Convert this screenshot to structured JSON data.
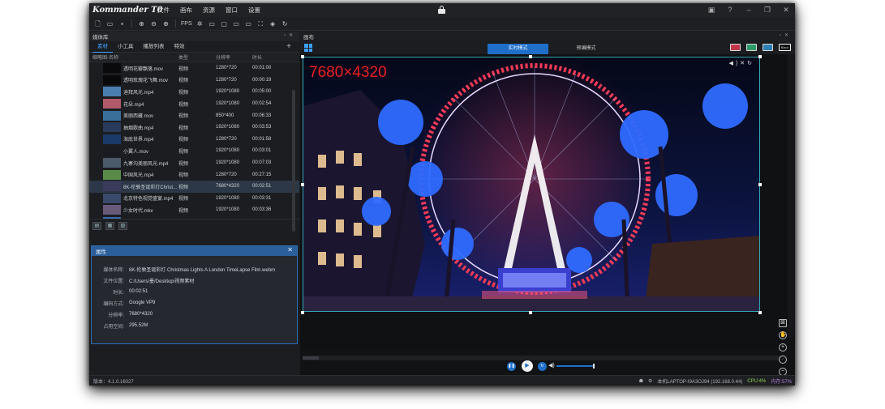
{
  "app": {
    "logo": "Kommander T0"
  },
  "menu": [
    "文件",
    "画布",
    "资源",
    "窗口",
    "设置"
  ],
  "toolbar": {
    "fps_label": "FPS"
  },
  "media_panel": {
    "title": "媒体库",
    "tabs": [
      "素材",
      "小工具",
      "播放列表",
      "特效"
    ],
    "active_tab": "素材",
    "columns": [
      "缩略图-名称",
      "类型",
      "分辨率",
      "时长"
    ],
    "rows": [
      {
        "name": "透明花瓣飘落.mov",
        "type": "视频",
        "res": "1280*720",
        "dur": "00:01:00"
      },
      {
        "name": "透明玫瑰花飞舞.mov",
        "type": "视频",
        "res": "1280*720",
        "dur": "00:00:19"
      },
      {
        "name": "迪拜风光.mp4",
        "type": "视频",
        "res": "1920*1080",
        "dur": "00:05:00"
      },
      {
        "name": "花朵.mp4",
        "type": "视频",
        "res": "1920*1080",
        "dur": "00:02:54"
      },
      {
        "name": "美丽西藏.mov",
        "type": "视频",
        "res": "850*400",
        "dur": "00:06:33"
      },
      {
        "name": "抽烟歌曲.mp4",
        "type": "视频",
        "res": "1920*1080",
        "dur": "00:03:53"
      },
      {
        "name": "海底世界.mp4",
        "type": "视频",
        "res": "1280*720",
        "dur": "00:01:58"
      },
      {
        "name": "小翼人.mov",
        "type": "视频",
        "res": "1920*1080",
        "dur": "00:03:01"
      },
      {
        "name": "九寨沟美丽风光.mp4",
        "type": "视频",
        "res": "1920*1080",
        "dur": "00:07:03"
      },
      {
        "name": "中国风光.mp4",
        "type": "视频",
        "res": "1280*720",
        "dur": "00:27:15"
      },
      {
        "name": "8K-伦敦圣诞彩灯Christ...",
        "type": "视频",
        "res": "7680*4320",
        "dur": "00:02:51",
        "selected": true
      },
      {
        "name": "北京特色视觉盛宴.mp4",
        "type": "视频",
        "res": "1920*1080",
        "dur": "00:03:31"
      },
      {
        "name": "少女时代.mkv",
        "type": "视频",
        "res": "1920*1080",
        "dur": "00:03:36"
      },
      {
        "name": "愤怒的小鸟.mp4",
        "type": "视频",
        "res": "1920*1080",
        "dur": "00:00:13"
      },
      {
        "name": "水果.mp4",
        "type": "视频",
        "res": "3840*2160",
        "dur": "00:04:31"
      },
      {
        "name": "音乐-花粥.mp3",
        "type": "音频",
        "res": "0*0",
        "dur": "00:03:16"
      }
    ]
  },
  "properties": {
    "title": "属性",
    "items": [
      {
        "key": "媒体名称:",
        "value": "8K-伦敦圣诞彩灯 Christmas Lights A London TimeLapse Film.webm"
      },
      {
        "key": "文件位置:",
        "value": "C:/Users/墨/Desktop/视频素材"
      },
      {
        "key": "时长:",
        "value": "00:02:51"
      },
      {
        "key": "编码方式:",
        "value": "Google VP9"
      },
      {
        "key": "分辨率:",
        "value": "7680*4320"
      },
      {
        "key": "占用空间:",
        "value": "295.52M"
      }
    ]
  },
  "canvas": {
    "title": "画布",
    "modes": [
      "实时模式",
      "预编模式"
    ],
    "active_mode": "实时模式",
    "color_buttons": [
      "",
      "",
      "",
      "Black"
    ],
    "overlay_resolution": "7680×4320"
  },
  "status": {
    "version": "版本：4.1.0.16027",
    "host": "本机LAPTOP-I9A3OJ94 (192.168.0.44)",
    "cpu": "CPU:4%",
    "mem": "内存:57%"
  },
  "playback": {
    "volume": 0.9
  },
  "colors": {
    "accent": "#1f6fc8",
    "selection_border": "#31a8b7",
    "resolution_text": "#ef1f24"
  }
}
